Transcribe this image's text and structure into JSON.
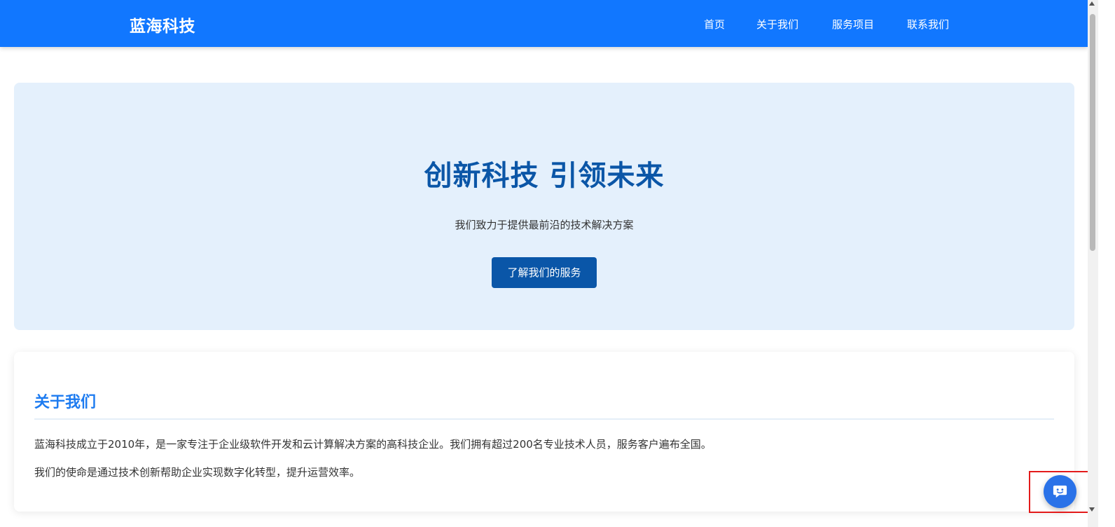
{
  "header": {
    "brand": "蓝海科技",
    "nav": [
      {
        "label": "首页"
      },
      {
        "label": "关于我们"
      },
      {
        "label": "服务项目"
      },
      {
        "label": "联系我们"
      }
    ]
  },
  "hero": {
    "title": "创新科技 引领未来",
    "subtitle": "我们致力于提供最前沿的技术解决方案",
    "button_label": "了解我们的服务"
  },
  "about": {
    "title": "关于我们",
    "paragraphs": [
      "蓝海科技成立于2010年，是一家专注于企业级软件开发和云计算解决方案的高科技企业。我们拥有超过200名专业技术人员，服务客户遍布全国。",
      "我们的使命是通过技术创新帮助企业实现数字化转型，提升运营效率。"
    ]
  },
  "chat_widget": {
    "icon": "chat-bot-icon"
  },
  "colors": {
    "header_bg": "#1177ff",
    "hero_bg": "#e4f0fc",
    "hero_title": "#0b56a7",
    "button_bg": "#0a56a8",
    "section_title": "#1d7bf0",
    "chat_button": "#2a72e8",
    "highlight_border": "#e31b1b"
  }
}
